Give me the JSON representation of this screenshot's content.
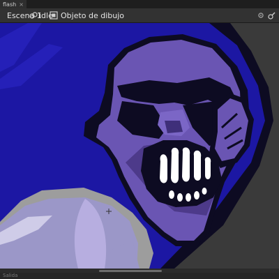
{
  "document_tab": {
    "label": "flash",
    "close_symbol": "×"
  },
  "edit_bar": {
    "scene": "Escena 1",
    "symbol": "idle",
    "object": "Objeto de dibujo",
    "icons": [
      "symbol-icon",
      "movie-clip-icon",
      "drawing-object-icon",
      "settings-gear-icon",
      "edit-multiple-icon"
    ]
  },
  "status": {
    "label": "Salida"
  },
  "colors": {
    "toolbar_bg": "#323232",
    "stage_bg": "#3a3a3a",
    "outline": "#0d0b22",
    "head_blue": "#1c17a3",
    "face_purple": "#6a55b3",
    "face_shadow": "#4d3a8a",
    "teeth": "#ffffff",
    "glove": "#9b97c8",
    "glove_light": "#b7aee0",
    "glove_outline": "#9d9d9d"
  }
}
